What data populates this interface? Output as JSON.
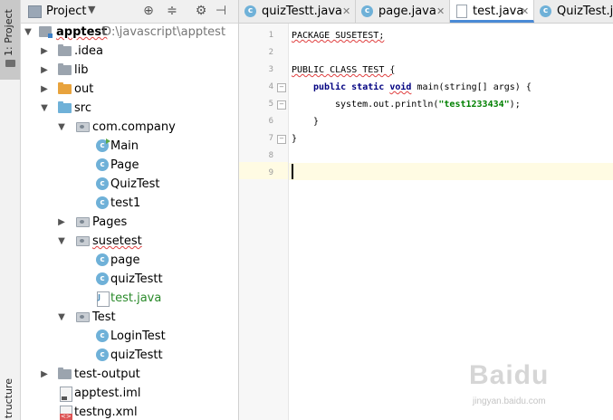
{
  "side_strip": {
    "project_tab": "1: Project",
    "structure_tab": "tructure"
  },
  "panel_header": {
    "title": "Project"
  },
  "tree": [
    {
      "label": "apptest",
      "path": "D:\\javascript\\apptest",
      "depth": 0,
      "expanded": true,
      "icon": "module-icon"
    },
    {
      "label": ".idea",
      "depth": 1,
      "expanded": false,
      "icon": "folder-icon"
    },
    {
      "label": "lib",
      "depth": 1,
      "expanded": false,
      "icon": "folder-icon"
    },
    {
      "label": "out",
      "depth": 1,
      "expanded": false,
      "icon": "folder-excluded-icon"
    },
    {
      "label": "src",
      "depth": 1,
      "expanded": true,
      "icon": "source-folder-icon"
    },
    {
      "label": "com.company",
      "depth": 2,
      "expanded": true,
      "icon": "package-icon"
    },
    {
      "label": "Main",
      "depth": 3,
      "icon": "class-run-icon"
    },
    {
      "label": "Page",
      "depth": 3,
      "icon": "class-icon"
    },
    {
      "label": "QuizTest",
      "depth": 3,
      "icon": "class-icon"
    },
    {
      "label": "test1",
      "depth": 3,
      "icon": "class-icon"
    },
    {
      "label": "Pages",
      "depth": 2,
      "expanded": false,
      "icon": "package-icon"
    },
    {
      "label": "susetest",
      "depth": 2,
      "expanded": true,
      "icon": "package-icon"
    },
    {
      "label": "page",
      "depth": 3,
      "icon": "class-icon"
    },
    {
      "label": "quizTestt",
      "depth": 3,
      "icon": "class-icon"
    },
    {
      "label": "test.java",
      "depth": 3,
      "icon": "java-file-icon"
    },
    {
      "label": "Test",
      "depth": 2,
      "expanded": true,
      "icon": "package-icon"
    },
    {
      "label": "LoginTest",
      "depth": 3,
      "icon": "class-icon"
    },
    {
      "label": "quizTestt",
      "depth": 3,
      "icon": "class-icon"
    },
    {
      "label": "test-output",
      "depth": 1,
      "expanded": false,
      "icon": "folder-icon"
    },
    {
      "label": "apptest.iml",
      "depth": 1,
      "icon": "iml-file-icon"
    },
    {
      "label": "testng.xml",
      "depth": 1,
      "icon": "xml-file-icon"
    }
  ],
  "tabs": [
    {
      "label": "quizTestt.java",
      "icon": "class-icon",
      "active": false
    },
    {
      "label": "page.java",
      "icon": "class-icon",
      "active": false
    },
    {
      "label": "test.java",
      "icon": "java-file-icon",
      "active": true
    },
    {
      "label": "QuizTest.ja",
      "icon": "class-icon",
      "active": false
    }
  ],
  "editor": {
    "line_numbers": [
      "1",
      "2",
      "3",
      "4",
      "5",
      "6",
      "7",
      "8",
      "9"
    ],
    "code": {
      "l1": "PACKAGE SUSETEST;",
      "l3": "PUBLIC CLASS TEST {",
      "l4_kw1": "public",
      "l4_kw2": "static",
      "l4_kw3": "void",
      "l4_rest": " main(string[] args) {",
      "l5_pre": "system.out.println(",
      "l5_str": "\"test1233434\"",
      "l5_post": ");",
      "l6": "}",
      "l7": "}"
    },
    "current_line": 9
  },
  "watermark": {
    "brand": "Baidu",
    "url": "jingyan.baidu.com"
  },
  "colors": {
    "accent": "#4a8ad6",
    "current_line": "#fffbe3",
    "selection": "#d5d5d5",
    "string": "#008000",
    "keyword": "#000080"
  }
}
